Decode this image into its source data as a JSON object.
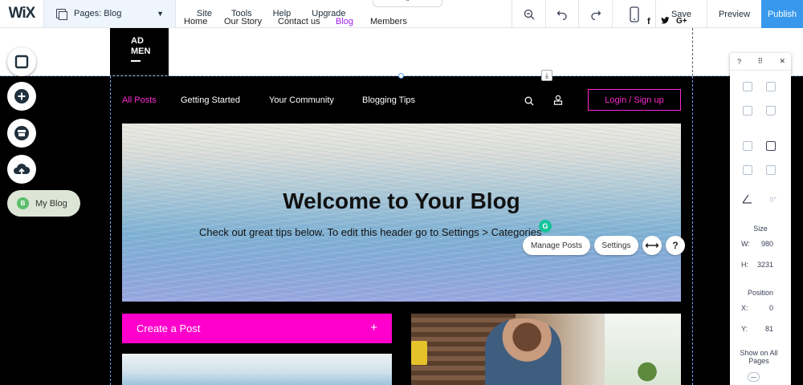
{
  "topbar": {
    "logo": "WiX",
    "pages_dropdown": "Pages: Blog",
    "menu": [
      "Site",
      "Tools",
      "Help",
      "Upgrade"
    ],
    "collapse_glyph": "⌃",
    "icons": [
      "zoom-out-icon",
      "undo-icon",
      "redo-icon",
      "mobile-icon"
    ],
    "save": "Save",
    "preview": "Preview",
    "publish": "Publish"
  },
  "site_header": {
    "brand_line1": "AD",
    "brand_line2": "MEN",
    "nav": [
      "Home",
      "Our Story",
      "Contact us",
      "Blog",
      "Members"
    ],
    "active_nav": "Blog",
    "social": [
      "f",
      "𝕥",
      "G+"
    ],
    "download_glyph": "⤓"
  },
  "left_tools": {
    "icons": [
      "background-icon",
      "add-icon",
      "store-icon",
      "upload-icon"
    ],
    "my_blog_badge": "B",
    "my_blog_label": "My Blog"
  },
  "blog": {
    "categories": [
      "All Posts",
      "Getting Started",
      "Your Community",
      "Blogging Tips"
    ],
    "login": "Login / Sign up",
    "hero_title": "Welcome to Your Blog",
    "hero_subtitle": "Check out great tips below. To edit this header go to Settings > Categories",
    "grammarly_badge": "G",
    "manage_posts": "Manage Posts",
    "settings": "Settings",
    "stretch_glyph": "⟷",
    "help_glyph": "?",
    "create_post": "Create a Post",
    "create_plus": "+"
  },
  "inspector": {
    "help": "?",
    "drag": "⠿",
    "close": "✕",
    "rotate_value": "0°",
    "size_label": "Size",
    "w_key": "W:",
    "w_value": "980",
    "h_key": "H:",
    "h_value": "3231",
    "position_label": "Position",
    "x_key": "X:",
    "x_value": "0",
    "y_key": "Y:",
    "y_value": "81",
    "show_all_pages": "Show on All Pages"
  },
  "colors": {
    "accent_pink": "#ff2ad4",
    "create_post_bg": "#ff00cc",
    "active_nav": "#a020f0",
    "publish_bg": "#3899ec"
  }
}
